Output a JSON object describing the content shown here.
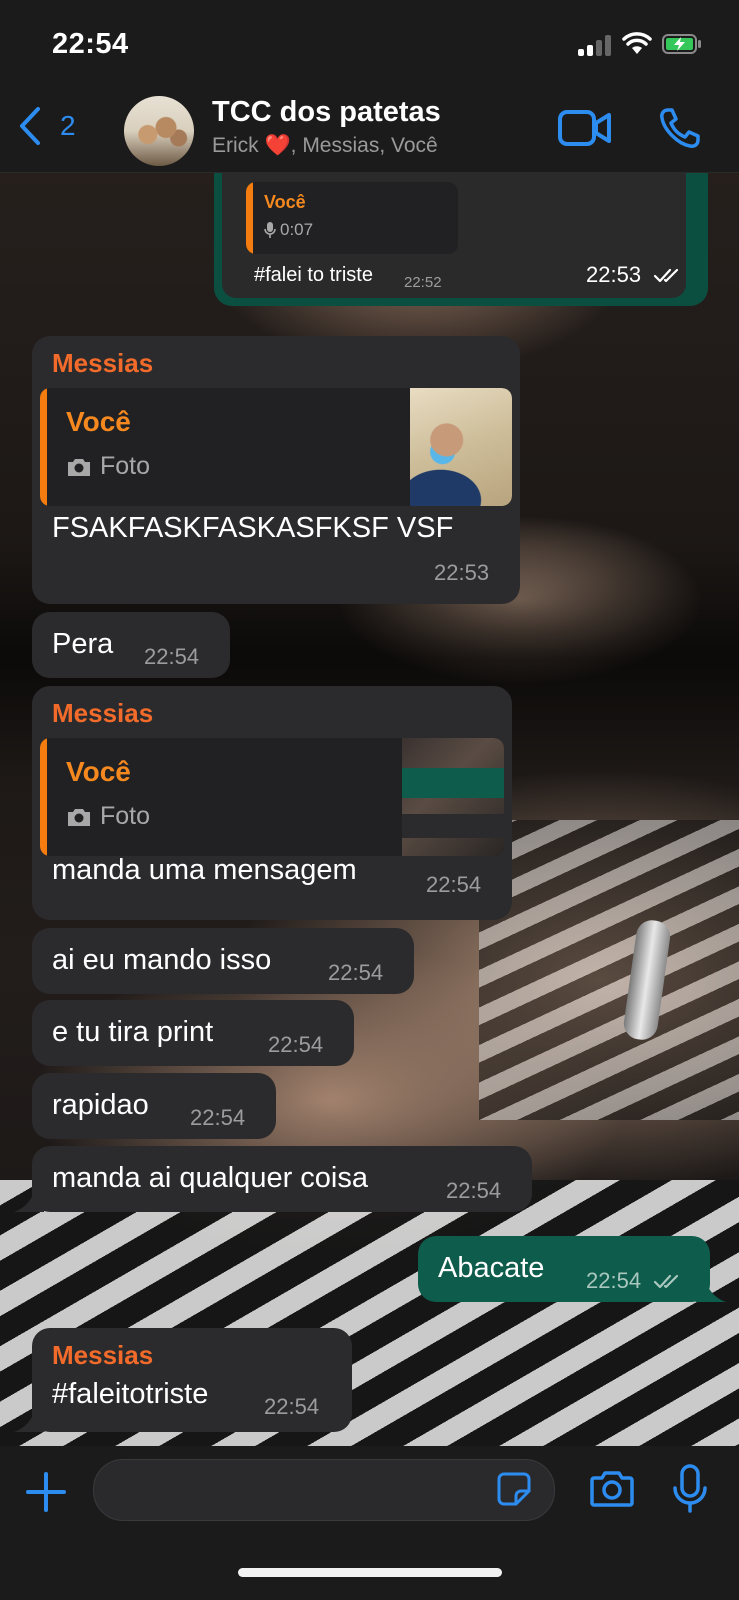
{
  "status_bar": {
    "time": "22:54"
  },
  "header": {
    "back_count": "2",
    "title": "TCC dos patetas",
    "subtitle": "Erick ❤️, Messias, Você"
  },
  "messages": [
    {
      "id": "m0",
      "direction": "outgoing",
      "quote": {
        "name": "Você",
        "text": "0:07"
      },
      "quote_text": "#falei to triste",
      "quote_time": "22:52",
      "time": "22:53",
      "status": "read"
    },
    {
      "id": "m1",
      "direction": "incoming",
      "sender": "Messias",
      "quote": {
        "name": "Você",
        "text": "Foto"
      },
      "text": "FSAKFASKFASKASFKSF VSF",
      "time": "22:53"
    },
    {
      "id": "m2",
      "direction": "incoming",
      "text": "Pera",
      "time": "22:54"
    },
    {
      "id": "m3",
      "direction": "incoming",
      "sender": "Messias",
      "quote": {
        "name": "Você",
        "text": "Foto"
      },
      "text": "manda uma mensagem",
      "time": "22:54"
    },
    {
      "id": "m4",
      "direction": "incoming",
      "text": "ai eu mando isso",
      "time": "22:54"
    },
    {
      "id": "m5",
      "direction": "incoming",
      "text": "e tu tira print",
      "time": "22:54"
    },
    {
      "id": "m6",
      "direction": "incoming",
      "text": "rapidao",
      "time": "22:54"
    },
    {
      "id": "m7",
      "direction": "incoming",
      "text": "manda ai qualquer coisa",
      "time": "22:54"
    },
    {
      "id": "m8",
      "direction": "outgoing",
      "text": "Abacate",
      "time": "22:54",
      "status": "delivered"
    },
    {
      "id": "m9",
      "direction": "incoming",
      "sender": "Messias",
      "text": "#faleitotriste",
      "time": "22:54"
    }
  ],
  "composer": {
    "placeholder": ""
  },
  "colors": {
    "accent_blue": "#2d8cf0",
    "outgoing_bubble": "#0e5c4b",
    "incoming_bubble": "#2b2b2d",
    "sender_orange": "#f26b2a",
    "quote_bar": "#f57c0e"
  },
  "icons": [
    "back-chevron-icon",
    "video-call-icon",
    "phone-icon",
    "plus-icon",
    "sticker-icon",
    "camera-icon",
    "microphone-icon",
    "double-check-icon",
    "mic-small-icon",
    "camera-small-icon"
  ]
}
